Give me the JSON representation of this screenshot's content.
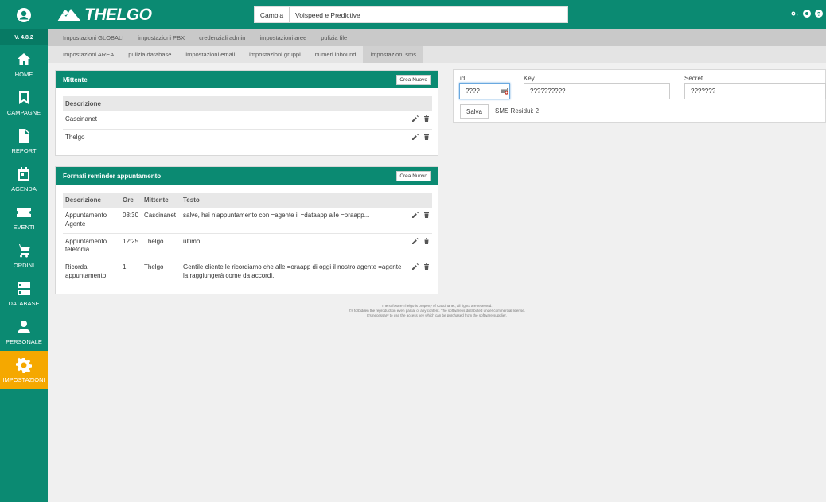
{
  "sidebar": {
    "version": "V. 4.8.2",
    "items": [
      {
        "label": "HOME",
        "icon": "home-icon"
      },
      {
        "label": "CAMPAGNE",
        "icon": "bookmark-icon"
      },
      {
        "label": "REPORT",
        "icon": "document-icon"
      },
      {
        "label": "AGENDA",
        "icon": "calendar-icon"
      },
      {
        "label": "EVENTI",
        "icon": "ticket-icon"
      },
      {
        "label": "ORDINI",
        "icon": "cart-icon"
      },
      {
        "label": "DATABASE",
        "icon": "server-icon"
      },
      {
        "label": "PERSONALE",
        "icon": "person-icon"
      },
      {
        "label": "IMPOSTAZIONI",
        "icon": "gear-icon"
      }
    ],
    "active": "IMPOSTAZIONI"
  },
  "header": {
    "logo_text": "THELGO",
    "cambia_label": "Cambia",
    "search_value": "Voispeed e Predictive"
  },
  "tabs_row1": [
    "Impostazioni GLOBALI",
    "impostazioni PBX",
    "credenziali admin",
    "impostazioni aree",
    "pulizia file"
  ],
  "tabs_row2": [
    "Impostazioni AREA",
    "pulizia database",
    "impostazioni email",
    "impostazioni gruppi",
    "numeri inbound",
    "impostazioni sms"
  ],
  "active_tab": "impostazioni sms",
  "mittente": {
    "title": "Mittente",
    "create_label": "Crea Nuovo",
    "col_descrizione": "Descrizione",
    "rows": [
      "Cascinanet",
      "Thelgo"
    ]
  },
  "formati": {
    "title": "Formati reminder appuntamento",
    "create_label": "Crea Nuovo",
    "columns": [
      "Descrizione",
      "Ore",
      "Mittente",
      "Testo"
    ],
    "rows": [
      {
        "descrizione": "Appuntamento Agente",
        "ore": "08:30",
        "mittente": "Cascinanet",
        "testo": "salve, hai n'appuntamento con =agente il =dataapp alle =oraapp..."
      },
      {
        "descrizione": "Appuntamento telefonia",
        "ore": "12:25",
        "mittente": "Thelgo",
        "testo": "ultimo!"
      },
      {
        "descrizione": "Ricorda appuntamento",
        "ore": "1",
        "mittente": "Thelgo",
        "testo": "Gentile cliente le ricordiamo che alle =oraapp di oggi il nostro agente =agente la raggiungerà come da accordi."
      }
    ]
  },
  "sms_form": {
    "id_label": "id",
    "id_value": "????",
    "key_label": "Key",
    "key_value": "??????????",
    "secret_label": "Secret",
    "secret_value": "???????",
    "save_label": "Salva",
    "residui": "SMS Residui: 2"
  },
  "footer": {
    "line1": "The software Thelgo is property of Cascinanet, all rights are reserved.",
    "line2": "It's forbidden the reproduction even partial of any content. The software is distributed under commercial license.",
    "line3": "It's necessary to use the access key which can be purchased from the software supplier."
  },
  "colors": {
    "primary": "#0b8a72",
    "active": "#f5a800"
  }
}
